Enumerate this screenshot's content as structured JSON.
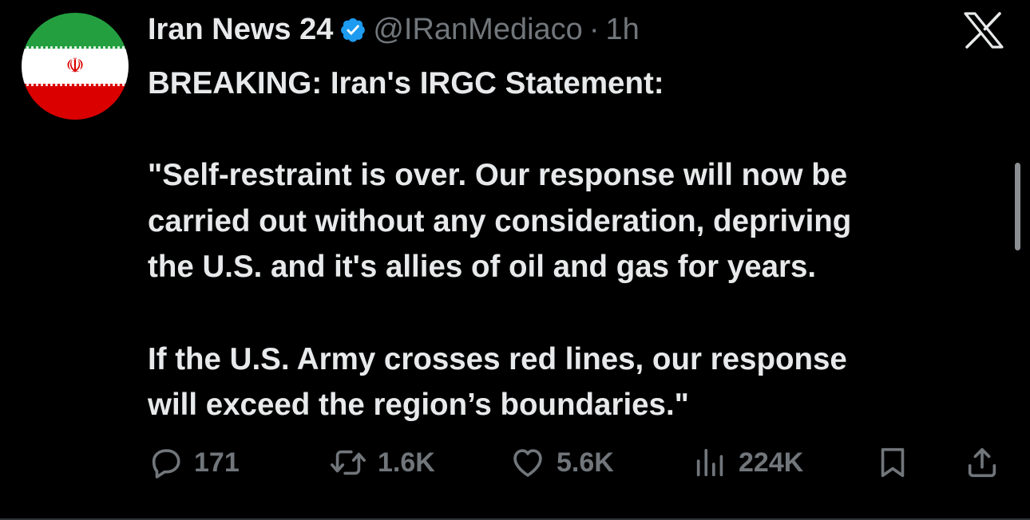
{
  "author": {
    "display_name": "Iran News 24",
    "handle": "@IRanMediaco",
    "separator": "·",
    "time": "1h",
    "avatar_icon": "iran-flag-icon",
    "verified": true
  },
  "platform_icon": "x-logo-icon",
  "tweet": {
    "line1": "BREAKING: Iran's IRGC Statement:",
    "para2_line1": "\"Self-restraint is over. Our response will now be",
    "para2_line2": "carried out without any consideration, depriving",
    "para2_line3": "the U.S. and it's allies of oil and gas for years.",
    "para3_line1": "If the U.S. Army crosses red lines, our response",
    "para3_line2": "will exceed the region’s boundaries.\""
  },
  "actions": {
    "replies": "171",
    "reposts": "1.6K",
    "likes": "5.6K",
    "views": "224K"
  },
  "colors": {
    "background": "#000000",
    "text": "#e7e9ea",
    "muted": "#71767b",
    "verified": "#1d9bf0"
  }
}
